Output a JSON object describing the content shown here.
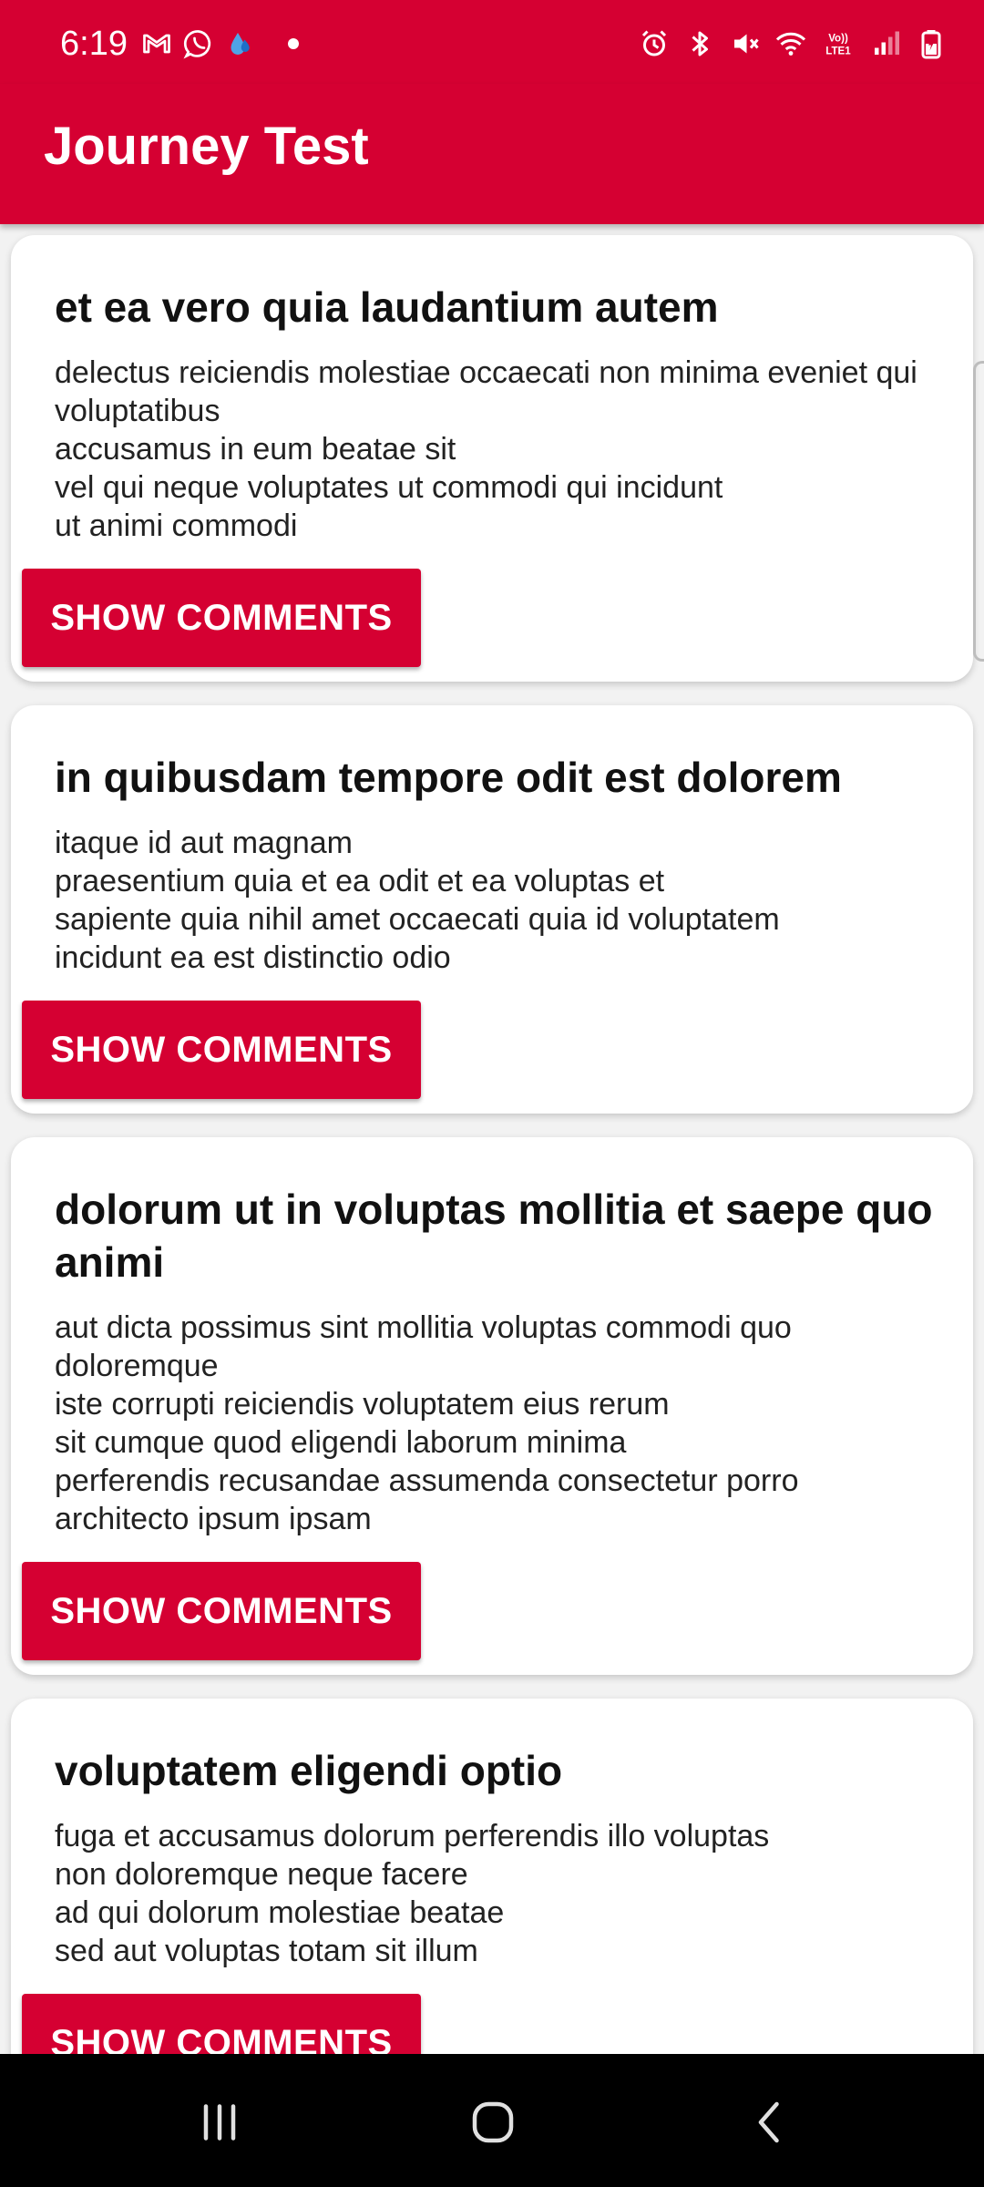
{
  "status_bar": {
    "time": "6:19",
    "left_icons": [
      "gmail-icon",
      "whatsapp-icon",
      "drop-app-icon",
      "notification-dot"
    ],
    "right_icons": [
      "alarm-icon",
      "bluetooth-icon",
      "mute-icon",
      "wifi-icon",
      "volte-icon",
      "signal-icon",
      "battery-charging-icon"
    ],
    "volte_label": "Vo))\nLTE1",
    "color": "#d50032"
  },
  "app_bar": {
    "title": "Journey Test",
    "color": "#d50032"
  },
  "posts": [
    {
      "title": "et ea vero quia laudantium autem",
      "body": "delectus reiciendis molestiae occaecati non minima eveniet qui\nvoluptatibus\naccusamus in eum beatae sit\nvel qui neque voluptates ut commodi qui incidunt\nut animi commodi",
      "button_label": "SHOW COMMENTS"
    },
    {
      "title": "in quibusdam tempore odit est dolorem",
      "body": "itaque id aut magnam\npraesentium quia et ea odit et ea voluptas et\nsapiente quia nihil amet occaecati quia id voluptatem\nincidunt ea est distinctio odio",
      "button_label": "SHOW COMMENTS"
    },
    {
      "title": "dolorum ut in voluptas mollitia et saepe quo animi",
      "body": "aut dicta possimus sint mollitia voluptas commodi quo\ndoloremque\niste corrupti reiciendis voluptatem eius rerum\nsit cumque quod eligendi laborum minima\nperferendis recusandae assumenda consectetur porro\narchitecto ipsum ipsam",
      "button_label": "SHOW COMMENTS"
    },
    {
      "title": "voluptatem eligendi optio",
      "body": "fuga et accusamus dolorum perferendis illo voluptas\nnon doloremque neque facere\nad qui dolorum molestiae beatae\nsed aut voluptas totam sit illum",
      "button_label": "SHOW COMMENTS"
    }
  ],
  "nav_bar": {
    "buttons": [
      "recents-icon",
      "home-icon",
      "back-icon"
    ]
  }
}
